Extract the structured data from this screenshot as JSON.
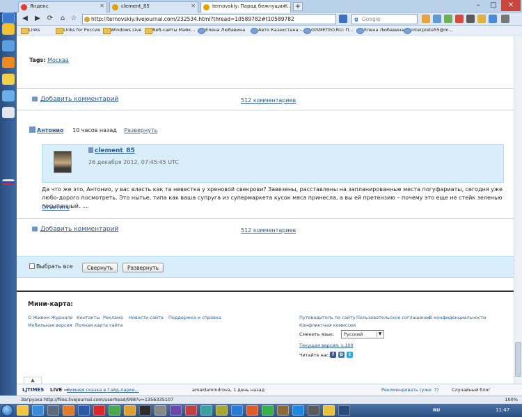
{
  "browser": {
    "tabs": [
      {
        "label": "Яндекс"
      },
      {
        "label": "clement_85"
      },
      {
        "label": "ternovskiy: Парад бежнущих..."
      }
    ],
    "new_tab": "+",
    "url": "http://ternovskiy.livejournal.com/232534.html?thread=10589782#t10589782",
    "search_placeholder": "Google",
    "search_logo": "g",
    "bookmarks": [
      "Links",
      "Links for Россия",
      "Windows Live",
      "Веб-сайты Майк...",
      "Елена Любавина",
      "Авто Казахстана -...",
      "GISMETEO.RU: П...",
      "Елена Любавина",
      "interprete55@m..."
    ],
    "nav": {
      "back": "◀",
      "forward": "▶",
      "reload": "⟳",
      "home": "⌂",
      "star": "☆"
    },
    "window": {
      "minimize": "–",
      "maximize": "□",
      "close": "✕"
    }
  },
  "page": {
    "tags_label": "Tags:",
    "tags_value": "Москва",
    "add_comment": "Добавить комментарий",
    "comment_count": "512 комментариев",
    "comment": {
      "author": "Антонио",
      "time": "10 часов назад",
      "expand": "Развернуть",
      "reply_user": "clement_85",
      "reply_date": "26 декабря 2012, 07:45:45 UTC",
      "text": "Да что же это, Антонио, у вас власть как та невестка у хреновой свекрови? Завезены, расставлены на запланированные места погуфариаты, сегодня уже любо-дорого посмотреть. Это нытье, типа как ваша супруга из супермаркета кусок мяса принесла, а вы ей претензию – почему это еще не стейк зеленью посыпанный.",
      "ellipsis": "...",
      "reply": "Ответить"
    },
    "select_all": "Выбрать все",
    "collapse_btn": "Свернуть",
    "expand_btn": "Развернуть"
  },
  "footer": {
    "minimap_title": "Мини-карта:",
    "links_left": [
      "О Живом Журнале",
      "Контакты",
      "Реклама",
      "Новости сайта",
      "Поддержка и справка"
    ],
    "links_left2": [
      "Мобильная версия",
      "Полная карта сайта"
    ],
    "links_right": [
      "Путеводитель по сайту",
      "Пользовательское соглашение",
      "О конфиденциальности"
    ],
    "links_right2": [
      "Конфликтная комиссия"
    ],
    "lang_label": "Сменить язык:",
    "lang_value": "Русский",
    "version": "Текущая версия: v.100",
    "read_us": "Читайте нас:",
    "social": [
      "f",
      "В",
      "t"
    ],
    "up": "▲"
  },
  "ljbar": {
    "logo": "LJTIMES",
    "live": "LIVE —",
    "news": "Зимняя сказка в Гайд-парке...",
    "user": "amaidamindrova, 1 день назад",
    "recommend": "Рекомендовать (уже: 7)",
    "random": "Случайный блог"
  },
  "status": {
    "text": "Загрузка http://files.livejournal.com/userhead/998?v=1356335107",
    "zoom": "100%"
  },
  "taskbar": {
    "lang": "RU",
    "time": "11:47"
  },
  "colors": {
    "accent_blue": "#2a5a9a",
    "highlight": "#d8eefa",
    "chrome": "#dbe7f4"
  }
}
